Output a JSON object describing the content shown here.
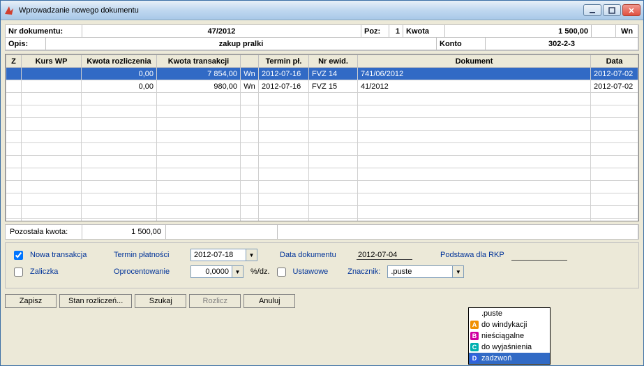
{
  "title": "Wprowadzanie nowego dokumentu",
  "header": {
    "nr_dokumentu_label": "Nr dokumentu:",
    "nr_dokumentu_value": "47/2012",
    "poz_label": "Poz:",
    "poz_value": "1",
    "kwota_label": "Kwota",
    "kwota_value": "1 500,00",
    "wn_label": "Wn",
    "opis_label": "Opis:",
    "opis_value": "zakup pralki",
    "konto_label": "Konto",
    "konto_value": "302-2-3"
  },
  "columns": {
    "z": "Z",
    "kurs_wp": "Kurs WP",
    "kwota_rozl": "Kwota rozliczenia",
    "kwota_trans": "Kwota transakcji",
    "side": "",
    "termin_pl": "Termin pł.",
    "nr_ewid": "Nr ewid.",
    "dokument": "Dokument",
    "data": "Data"
  },
  "rows": [
    {
      "sel": true,
      "kurs": "",
      "rozl": "0,00",
      "trans": "7 854,00",
      "side": "Wn",
      "termin": "2012-07-16",
      "ewid": "FVZ   14",
      "dok": "741/06/2012",
      "data": "2012-07-02"
    },
    {
      "sel": false,
      "kurs": "",
      "rozl": "0,00",
      "trans": "980,00",
      "side": "Wn",
      "termin": "2012-07-16",
      "ewid": "FVZ   15",
      "dok": "41/2012",
      "data": "2012-07-02"
    }
  ],
  "footer": {
    "pozostala_label": "Pozostała kwota:",
    "pozostala_value": "1 500,00"
  },
  "form": {
    "nowa_trans_label": "Nowa transakcja",
    "zaliczka_label": "Zaliczka",
    "termin_label": "Termin płatności",
    "termin_value": "2012-07-18",
    "oproc_label": "Oprocentowanie",
    "oproc_value": "0,0000",
    "pct_label": "%/dz.",
    "data_dok_label": "Data dokumentu",
    "data_dok_value": "2012-07-04",
    "ustawowe_label": "Ustawowe",
    "znacznik_label": "Znacznik:",
    "znacznik_value": ".puste",
    "podstawa_label": "Podstawa dla RKP"
  },
  "buttons": {
    "zapisz": "Zapisz",
    "stan": "Stan rozliczeń...",
    "szukaj": "Szukaj",
    "rozlicz": "Rozlicz",
    "anuluj": "Anuluj"
  },
  "dropdown": [
    {
      "badge": "",
      "text": ".puste"
    },
    {
      "badge": "A",
      "cls": "badge-a",
      "text": "do windykacji"
    },
    {
      "badge": "B",
      "cls": "badge-b",
      "text": "nieściągalne"
    },
    {
      "badge": "C",
      "cls": "badge-c",
      "text": "do wyjaśnienia"
    },
    {
      "badge": "D",
      "cls": "badge-d",
      "text": "zadzwoń",
      "selected": true
    }
  ]
}
